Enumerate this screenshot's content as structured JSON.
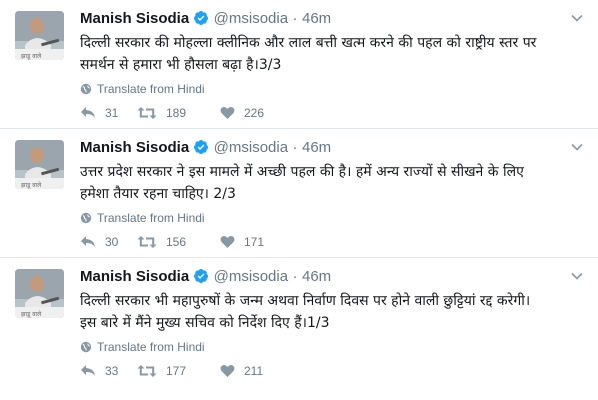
{
  "tweets": [
    {
      "name": "Manish Sisodia",
      "handle": "@msisodia",
      "separator": "·",
      "time": "46m",
      "text_line1": "दिल्ली सरकार की मोहल्ला क्लीनिक और लाल बत्ती खत्म करने की पहल को राष्ट्रीय स्तर पर",
      "text_line2": "समर्थन से हमारा भी हौसला बढ़ा है।3/3",
      "translate": "Translate from Hindi",
      "replies": "31",
      "retweets": "189",
      "likes": "226"
    },
    {
      "name": "Manish Sisodia",
      "handle": "@msisodia",
      "separator": "·",
      "time": "46m",
      "text_line1": "उत्तर प्रदेश सरकार ने इस मामले में अच्छी पहल की है। हमें अन्य राज्यों से सीखने के लिए",
      "text_line2": "हमेशा तैयार रहना चाहिए। 2/3",
      "translate": "Translate from Hindi",
      "replies": "30",
      "retweets": "156",
      "likes": "171"
    },
    {
      "name": "Manish Sisodia",
      "handle": "@msisodia",
      "separator": "·",
      "time": "46m",
      "text_line1": "दिल्ली सरकार भी महापुरुषों के जन्म अथवा निर्वाण दिवस पर होने वाली छुट्टियां रद्द करेगी।",
      "text_line2": "इस बारे में मैंने मुख्य सचिव को निर्देश दिए हैं।1/3",
      "translate": "Translate from Hindi",
      "replies": "33",
      "retweets": "177",
      "likes": "211"
    }
  ],
  "colors": {
    "verified": "#1da1f2",
    "muted": "#657786",
    "text": "#14171a",
    "divider": "#e1e8ed"
  },
  "icons": [
    "verified-badge-icon",
    "chevron-down-icon",
    "globe-icon",
    "reply-icon",
    "retweet-icon",
    "like-icon"
  ]
}
